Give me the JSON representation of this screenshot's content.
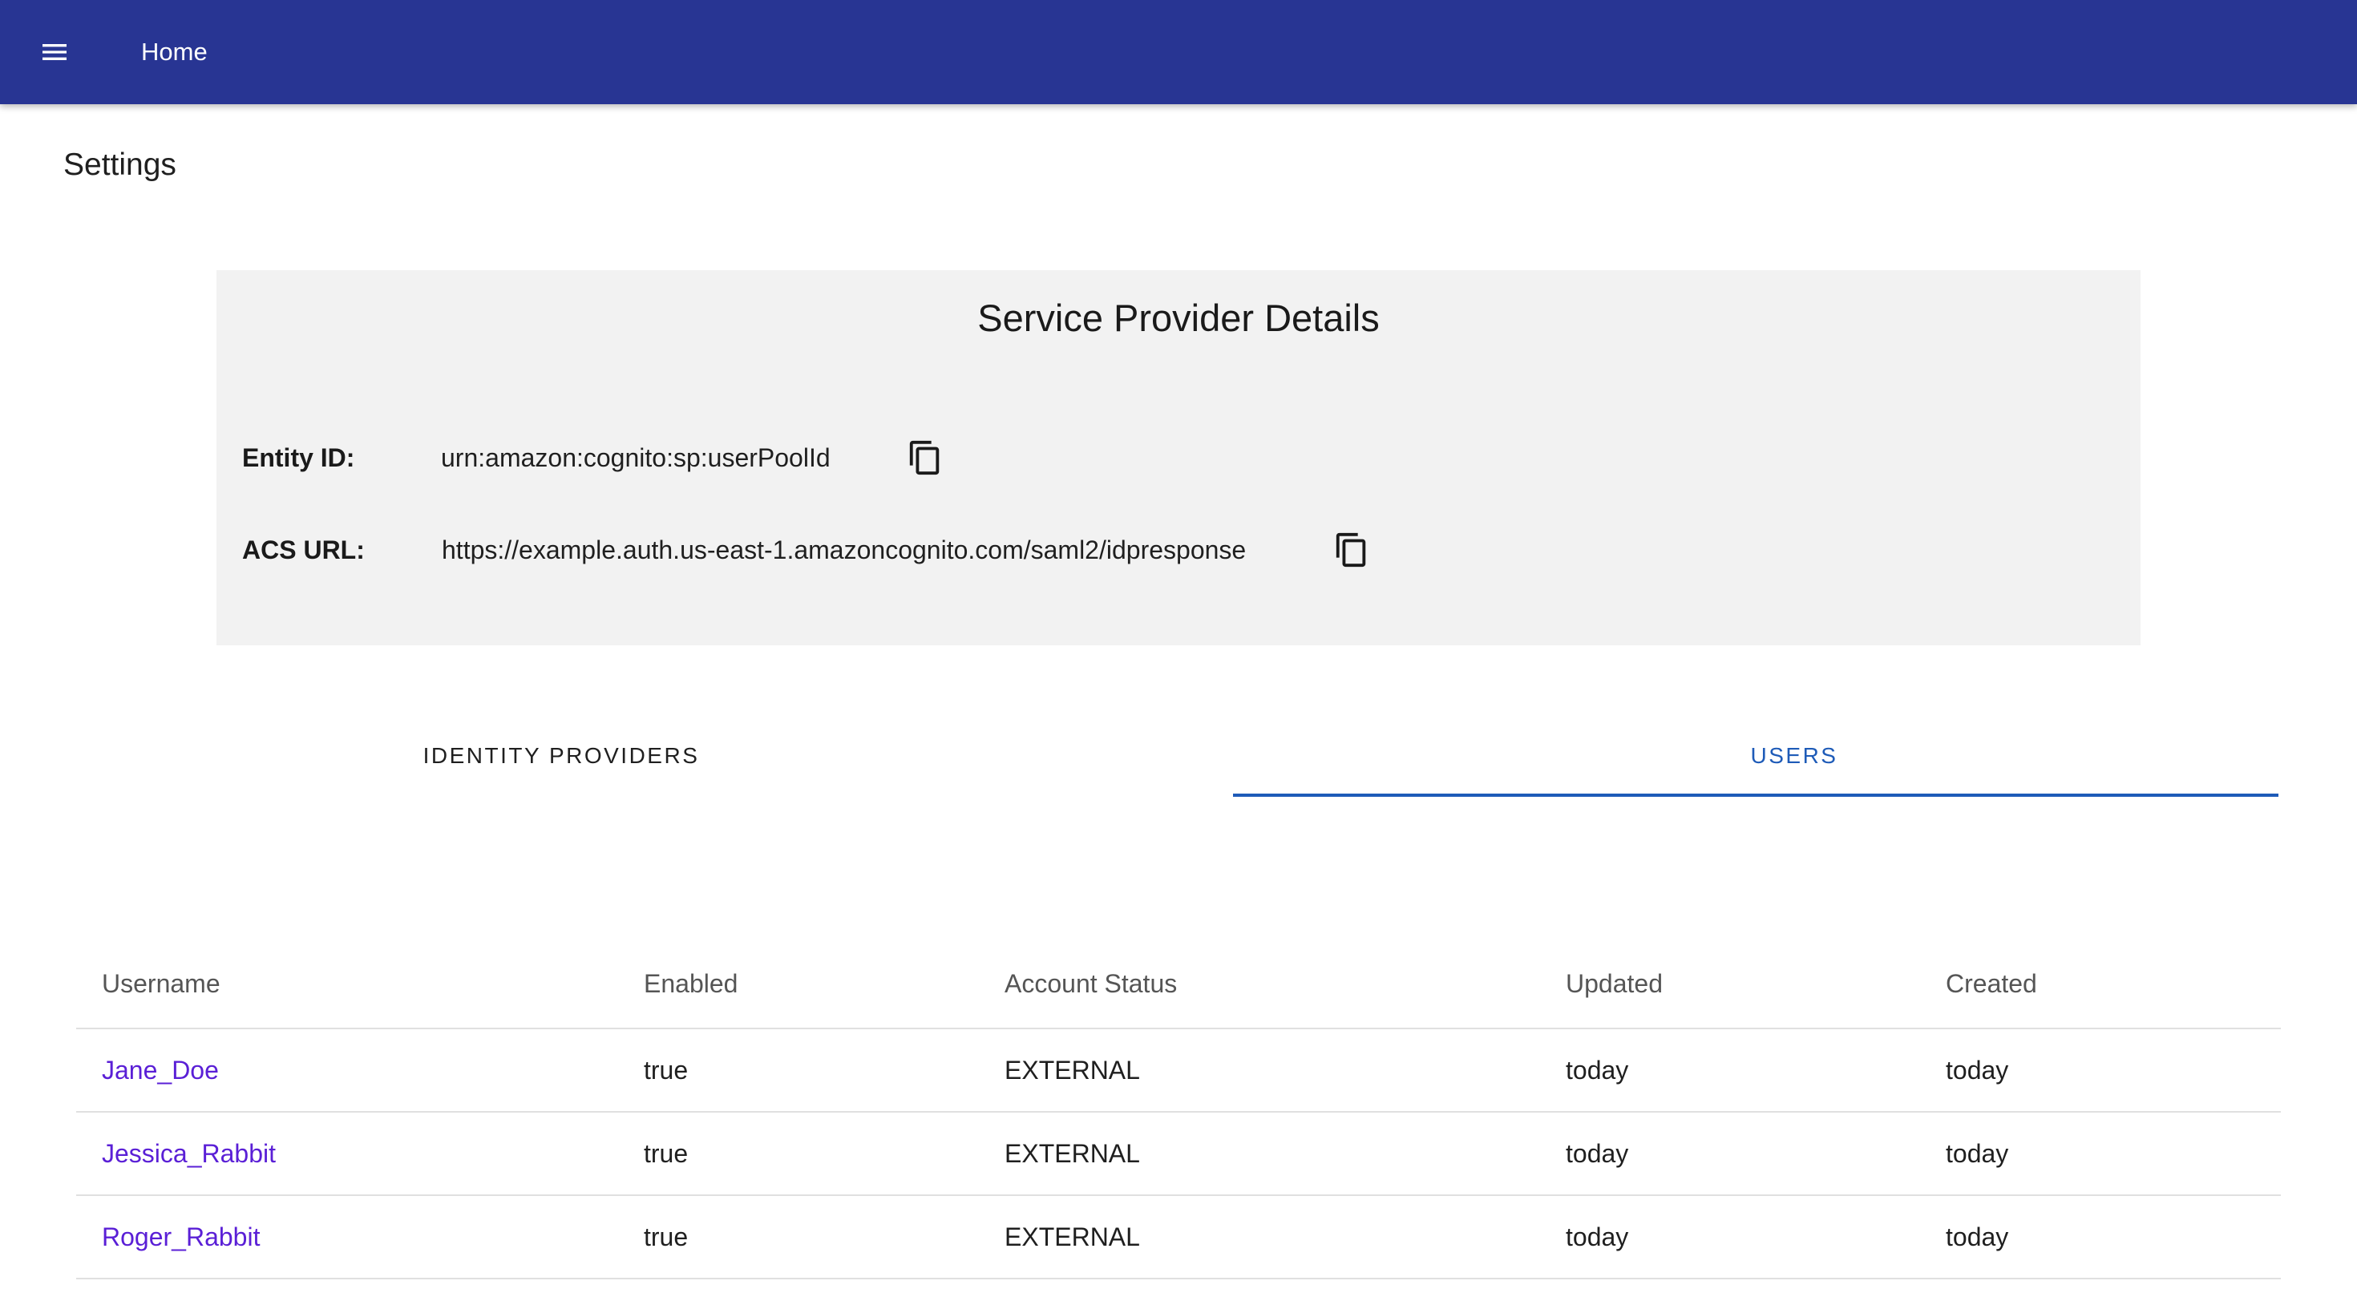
{
  "appbar": {
    "title": "Home",
    "background": "#283593",
    "menu_icon": "menu-icon"
  },
  "page": {
    "title": "Settings"
  },
  "service_provider": {
    "title": "Service Provider Details",
    "rows": [
      {
        "label": "Entity ID:",
        "value": "urn:amazon:cognito:sp:userPoolId",
        "action_icon": "copy-icon"
      },
      {
        "label": "ACS URL:",
        "value": "https://example.auth.us-east-1.amazoncognito.com/saml2/idpresponse",
        "action_icon": "copy-icon"
      }
    ]
  },
  "tabs": {
    "items": [
      {
        "label": "IDENTITY PROVIDERS",
        "selected": false
      },
      {
        "label": "USERS",
        "selected": true
      }
    ],
    "accent": "#1e5bb8"
  },
  "users_table": {
    "columns": [
      "Username",
      "Enabled",
      "Account Status",
      "Updated",
      "Created"
    ],
    "rows": [
      {
        "username": "Jane_Doe",
        "enabled": "true",
        "status": "EXTERNAL",
        "updated": "today",
        "created": "today"
      },
      {
        "username": "Jessica_Rabbit",
        "enabled": "true",
        "status": "EXTERNAL",
        "updated": "today",
        "created": "today"
      },
      {
        "username": "Roger_Rabbit",
        "enabled": "true",
        "status": "EXTERNAL",
        "updated": "today",
        "created": "today"
      }
    ],
    "link_color": "#5a1fd6"
  }
}
